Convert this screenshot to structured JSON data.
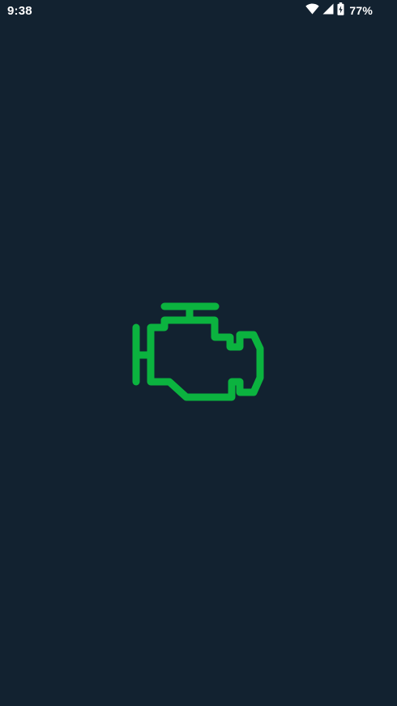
{
  "status_bar": {
    "time": "9:38",
    "battery_percent": "77%",
    "icons": [
      "wifi-icon",
      "cellular-signal-icon",
      "battery-charging-icon"
    ]
  },
  "splash": {
    "icon": "check-engine-icon",
    "icon_color": "#0bb33f",
    "background_color": "#122230"
  }
}
